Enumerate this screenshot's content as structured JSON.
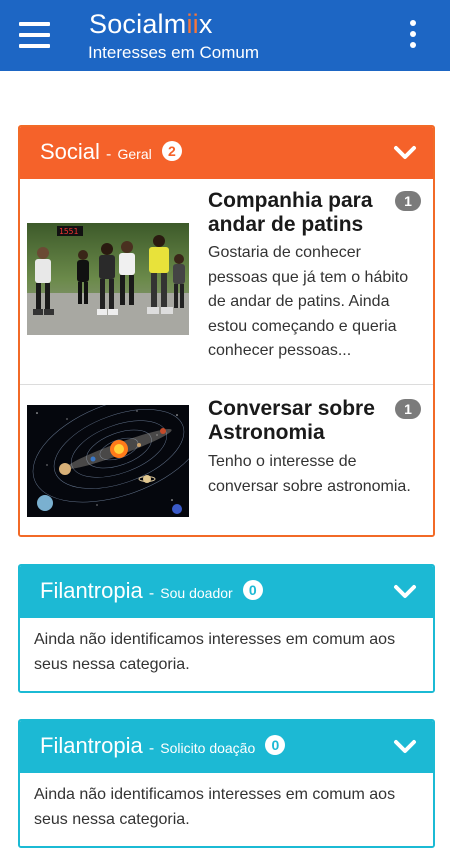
{
  "appbar": {
    "brand_prefix": "Socialm",
    "brand_highlight": "ii",
    "brand_suffix": "x",
    "subtitle": "Interesses em Comum",
    "menu_icon": "hamburger-menu-icon",
    "more_icon": "more-vertical-icon"
  },
  "categories": [
    {
      "title": "Social",
      "separator": "-",
      "subtitle": "Geral",
      "count": "2",
      "color": "#f5622a",
      "items": [
        {
          "title": "Companhia para andar de patins",
          "description": "Gostaria de conhecer pessoas que já tem o hábito de andar de patins. Ainda estou começando e queria conhecer pessoas...",
          "count": "1",
          "image": "rollerblading-group-photo"
        },
        {
          "title": "Conversar sobre Astronomia",
          "description": "Tenho o interesse de conversar sobre astronomia.",
          "count": "1",
          "image": "solar-system-illustration"
        }
      ]
    },
    {
      "title": "Filantropia",
      "separator": "-",
      "subtitle": "Sou doador",
      "count": "0",
      "color": "#1cb9d4",
      "empty_message": "Ainda não identificamos interesses em comum aos seus nessa categoria."
    },
    {
      "title": "Filantropia",
      "separator": "-",
      "subtitle": "Solicito doação",
      "count": "0",
      "color": "#1cb9d4",
      "empty_message": "Ainda não identificamos interesses em comum aos seus nessa categoria."
    }
  ]
}
